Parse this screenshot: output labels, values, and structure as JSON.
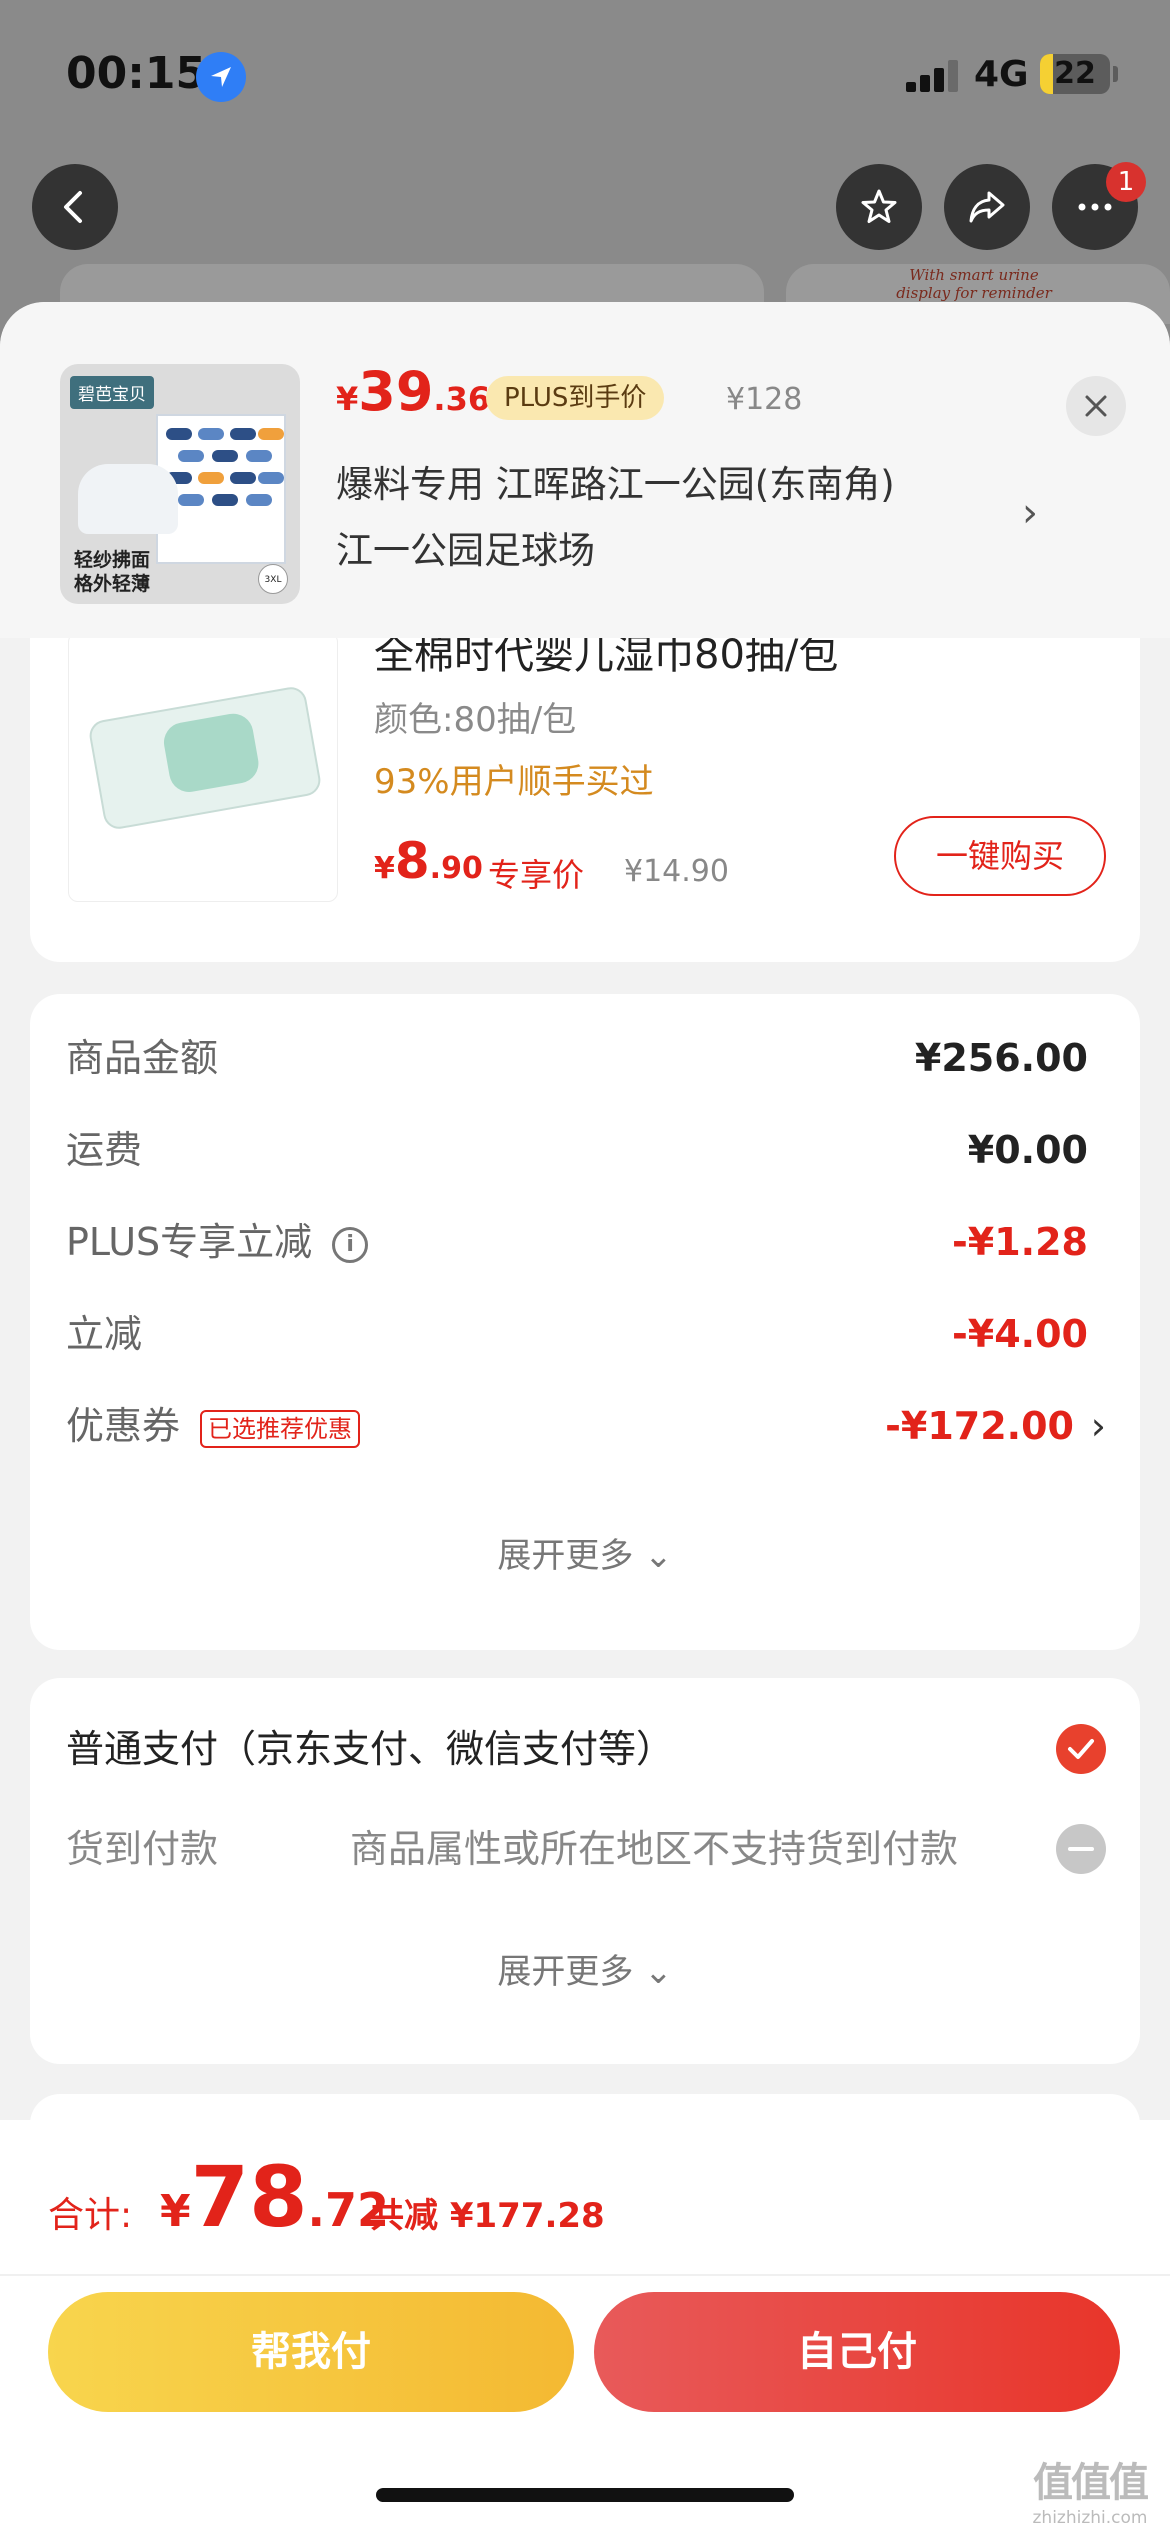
{
  "status_bar": {
    "time": "00:15",
    "network": "4G",
    "battery": "22"
  },
  "nav": {
    "notification_count": "1"
  },
  "bg_card_text": "With smart urine display for reminder",
  "header": {
    "product_image": {
      "brand": "碧芭宝贝",
      "caption_line1": "轻纱拂面",
      "caption_line2": "格外轻薄",
      "size": "3XL"
    },
    "price_currency": "¥",
    "price_int": "39",
    "price_dec": ".36",
    "plus_tag": "PLUS到手价",
    "original_price": "¥128",
    "address_line1": "爆料专用  江晖路江一公园(东南角)",
    "address_line2": "江一公园足球场"
  },
  "upsell": {
    "title": "全棉时代婴儿湿巾80抽/包",
    "spec": "颜色:80抽/包",
    "bought": "93%用户顺手买过",
    "price_currency": "¥",
    "price_int": "8",
    "price_dec": ".90",
    "exclusive_label": "专享价",
    "original_price": "¥14.90",
    "buy_button": "一键购买"
  },
  "summary": {
    "rows": [
      {
        "label": "商品金额",
        "value": "¥256.00"
      },
      {
        "label": "运费",
        "value": "¥0.00"
      },
      {
        "label": "PLUS专享立减",
        "value": "-¥1.28"
      },
      {
        "label": "立减",
        "value": "-¥4.00"
      },
      {
        "label": "优惠券",
        "value": "-¥172.00",
        "tag": "已选推荐优惠"
      }
    ],
    "expand_more": "展开更多"
  },
  "payment": {
    "normal_label": "普通支付（京东支付、微信支付等）",
    "cod_label": "货到付款",
    "cod_note": "商品属性或所在地区不支持货到付款",
    "expand_more": "展开更多"
  },
  "footer": {
    "total_label": "合计:",
    "total_currency": "¥",
    "total_int": "78",
    "total_dec": ".72",
    "total_saved": "共减 ¥177.28",
    "help_pay_button": "帮我付",
    "self_pay_button": "自己付"
  },
  "watermark": {
    "line1": "值值值",
    "line2": "zhizhizhi.com"
  },
  "colors": {
    "accent_red": "#e2231a",
    "help_yellow": "#f4b932",
    "check_red": "#e8412d"
  }
}
